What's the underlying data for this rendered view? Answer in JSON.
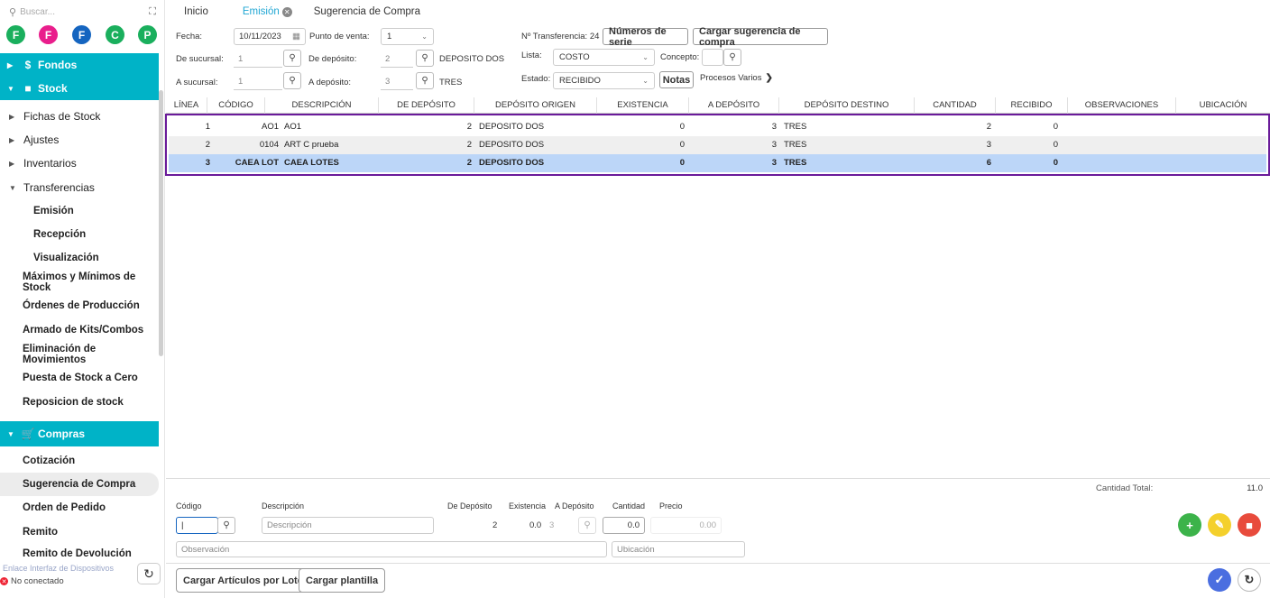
{
  "sidebar": {
    "search_placeholder": "Buscar...",
    "circles": [
      {
        "letter": "F",
        "color": "#1aaf5d"
      },
      {
        "letter": "F",
        "color": "#e91e8c"
      },
      {
        "letter": "F",
        "color": "#1565c0"
      },
      {
        "letter": "C",
        "color": "#1aaf5d"
      },
      {
        "letter": "P",
        "color": "#1aaf5d"
      }
    ],
    "sections": {
      "fondos": "Fondos",
      "stock": "Stock",
      "compras": "Compras"
    },
    "stock_items": {
      "fichas": "Fichas de Stock",
      "ajustes": "Ajustes",
      "inventarios": "Inventarios",
      "transferencias": "Transferencias",
      "emision": "Emisión",
      "recepcion": "Recepción",
      "visualizacion": "Visualización",
      "maximos": "Máximos y Mínimos de Stock",
      "ordenes": "Órdenes de Producción",
      "armado": "Armado de Kits/Combos",
      "eliminacion": "Eliminación de Movimientos",
      "puesta": "Puesta de Stock a Cero",
      "reposicion": "Reposicion de stock"
    },
    "compras_items": {
      "cotizacion": "Cotización",
      "sugerencia": "Sugerencia de Compra",
      "orden": "Orden de Pedido",
      "remito": "Remito",
      "remito_dev": "Remito de Devolución"
    },
    "footer_link": "Enlace Interfaz de Dispositivos",
    "footer_status": "No conectado"
  },
  "tabs": {
    "inicio": "Inicio",
    "emision": "Emisión",
    "sugerencia": "Sugerencia de Compra"
  },
  "header": {
    "fecha_label": "Fecha:",
    "fecha_value": "10/11/2023",
    "punto_label": "Punto de venta:",
    "punto_value": "1",
    "ntrans_label": "Nº Transferencia:",
    "ntrans_value": "24",
    "numeros_btn": "Números de serie",
    "cargar_sug_btn": "Cargar sugerencia de compra",
    "de_suc_label": "De sucursal:",
    "de_suc_value": "1",
    "de_dep_label": "De depósito:",
    "de_dep_value": "2",
    "de_dep_name": "DEPOSITO DOS",
    "lista_label": "Lista:",
    "lista_value": "COSTO",
    "concepto_label": "Concepto:",
    "a_suc_label": "A sucursal:",
    "a_suc_value": "1",
    "a_dep_label": "A depósito:",
    "a_dep_value": "3",
    "a_dep_name": "TRES",
    "estado_label": "Estado:",
    "estado_value": "RECIBIDO",
    "notas_btn": "Notas",
    "procesos_label": "Procesos Varios"
  },
  "table": {
    "headers": {
      "linea": "LÍNEA",
      "codigo": "CÓDIGO",
      "descripcion": "DESCRIPCIÓN",
      "de_deposito": "DE DEPÓSITO",
      "deposito_origen": "DEPÓSITO ORIGEN",
      "existencia": "EXISTENCIA",
      "a_deposito": "A DEPÓSITO",
      "deposito_destino": "DEPÓSITO DESTINO",
      "cantidad": "CANTIDAD",
      "recibido": "RECIBIDO",
      "observaciones": "OBSERVACIONES",
      "ubicacion": "UBICACIÓN"
    },
    "rows": [
      {
        "linea": "1",
        "codigo": "AO1",
        "descripcion": "AO1",
        "de_dep": "2",
        "origen": "DEPOSITO DOS",
        "existencia": "0",
        "a_dep": "3",
        "destino": "TRES",
        "cantidad": "2",
        "recibido": "0"
      },
      {
        "linea": "2",
        "codigo": "0104",
        "descripcion": "ART C prueba",
        "de_dep": "2",
        "origen": "DEPOSITO DOS",
        "existencia": "0",
        "a_dep": "3",
        "destino": "TRES",
        "cantidad": "3",
        "recibido": "0"
      },
      {
        "linea": "3",
        "codigo": "CAEA LOT",
        "descripcion": "CAEA LOTES",
        "de_dep": "2",
        "origen": "DEPOSITO DOS",
        "existencia": "0",
        "a_dep": "3",
        "destino": "TRES",
        "cantidad": "6",
        "recibido": "0"
      }
    ]
  },
  "bottom": {
    "total_label": "Cantidad Total:",
    "total_value": "11.0",
    "codigo_label": "Código",
    "descripcion_label": "Descripción",
    "de_dep_label": "De Depósito",
    "existencia_label": "Existencia",
    "a_dep_label": "A Depósito",
    "cantidad_label": "Cantidad",
    "precio_label": "Precio",
    "descripcion_placeholder": "Descripción",
    "de_dep_value": "2",
    "existencia_value": "0.0",
    "a_dep_value": "3",
    "cantidad_value": "0.0",
    "precio_value": "0.00",
    "observacion_placeholder": "Observación",
    "ubicacion_placeholder": "Ubicación",
    "cargar_lote_btn": "Cargar Artículos por Lote",
    "cargar_plantilla_btn": "Cargar plantilla"
  },
  "colors": {
    "accent": "#00b3c7",
    "selected_row": "#bcd6f8",
    "frame": "#6a1b9a",
    "add": "#3cb34a",
    "edit": "#f4d02c",
    "delete": "#e84b3c",
    "confirm": "#4a6ee0"
  }
}
